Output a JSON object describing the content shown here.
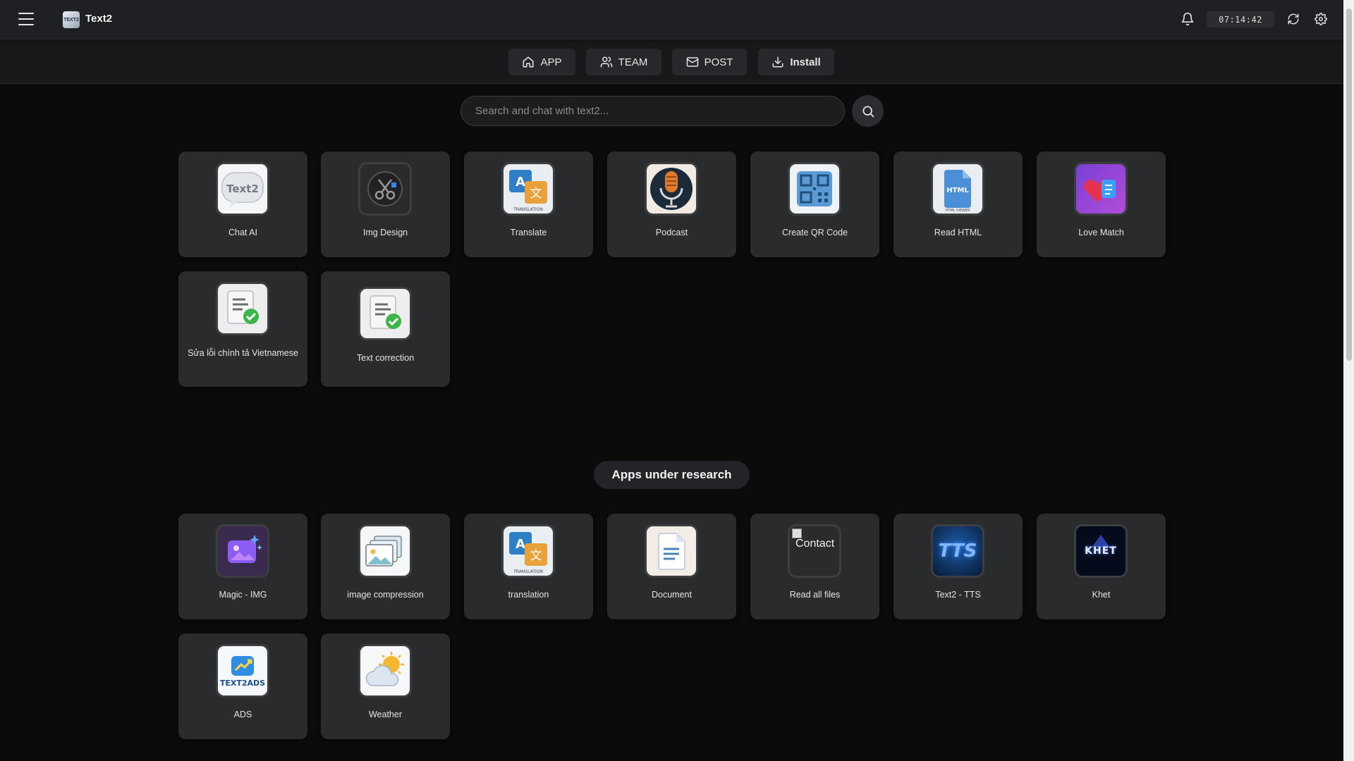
{
  "header": {
    "app_title": "Text2",
    "logo_text": "TEXT2",
    "clock": "07:14:42"
  },
  "nav": {
    "app": "APP",
    "team": "TEAM",
    "post": "POST",
    "install": "Install"
  },
  "search": {
    "placeholder": "Search and chat with text2..."
  },
  "apps": [
    {
      "label": "Chat AI",
      "icon": "text2-chat-icon"
    },
    {
      "label": "Img Design",
      "icon": "scissors-icon"
    },
    {
      "label": "Translate",
      "icon": "translation-icon"
    },
    {
      "label": "Podcast",
      "icon": "microphone-icon"
    },
    {
      "label": "Create QR Code",
      "icon": "qr-code-icon"
    },
    {
      "label": "Read HTML",
      "icon": "html-file-icon"
    },
    {
      "label": "Love Match",
      "icon": "heart-icon"
    },
    {
      "label": "Sửa lỗi chính tả Vietnamese",
      "icon": "document-check-icon"
    },
    {
      "label": "Text correction",
      "icon": "document-check-icon"
    }
  ],
  "research_section_title": "Apps under research",
  "research_apps": [
    {
      "label": "Magic - IMG",
      "icon": "magic-image-icon"
    },
    {
      "label": "image compression",
      "icon": "image-stack-icon"
    },
    {
      "label": "translation",
      "icon": "translation-icon"
    },
    {
      "label": "Document",
      "icon": "document-icon"
    },
    {
      "label": "Read all files",
      "icon": "broken-image-icon",
      "alt_text": "Contact"
    },
    {
      "label": "Text2 - TTS",
      "icon": "tts-icon",
      "icon_text": "TTS"
    },
    {
      "label": "Khet",
      "icon": "khet-logo-icon",
      "icon_text": "KHET"
    },
    {
      "label": "ADS",
      "icon": "ads-icon",
      "icon_text": "TEXT2ADS"
    },
    {
      "label": "Weather",
      "icon": "weather-icon"
    }
  ]
}
